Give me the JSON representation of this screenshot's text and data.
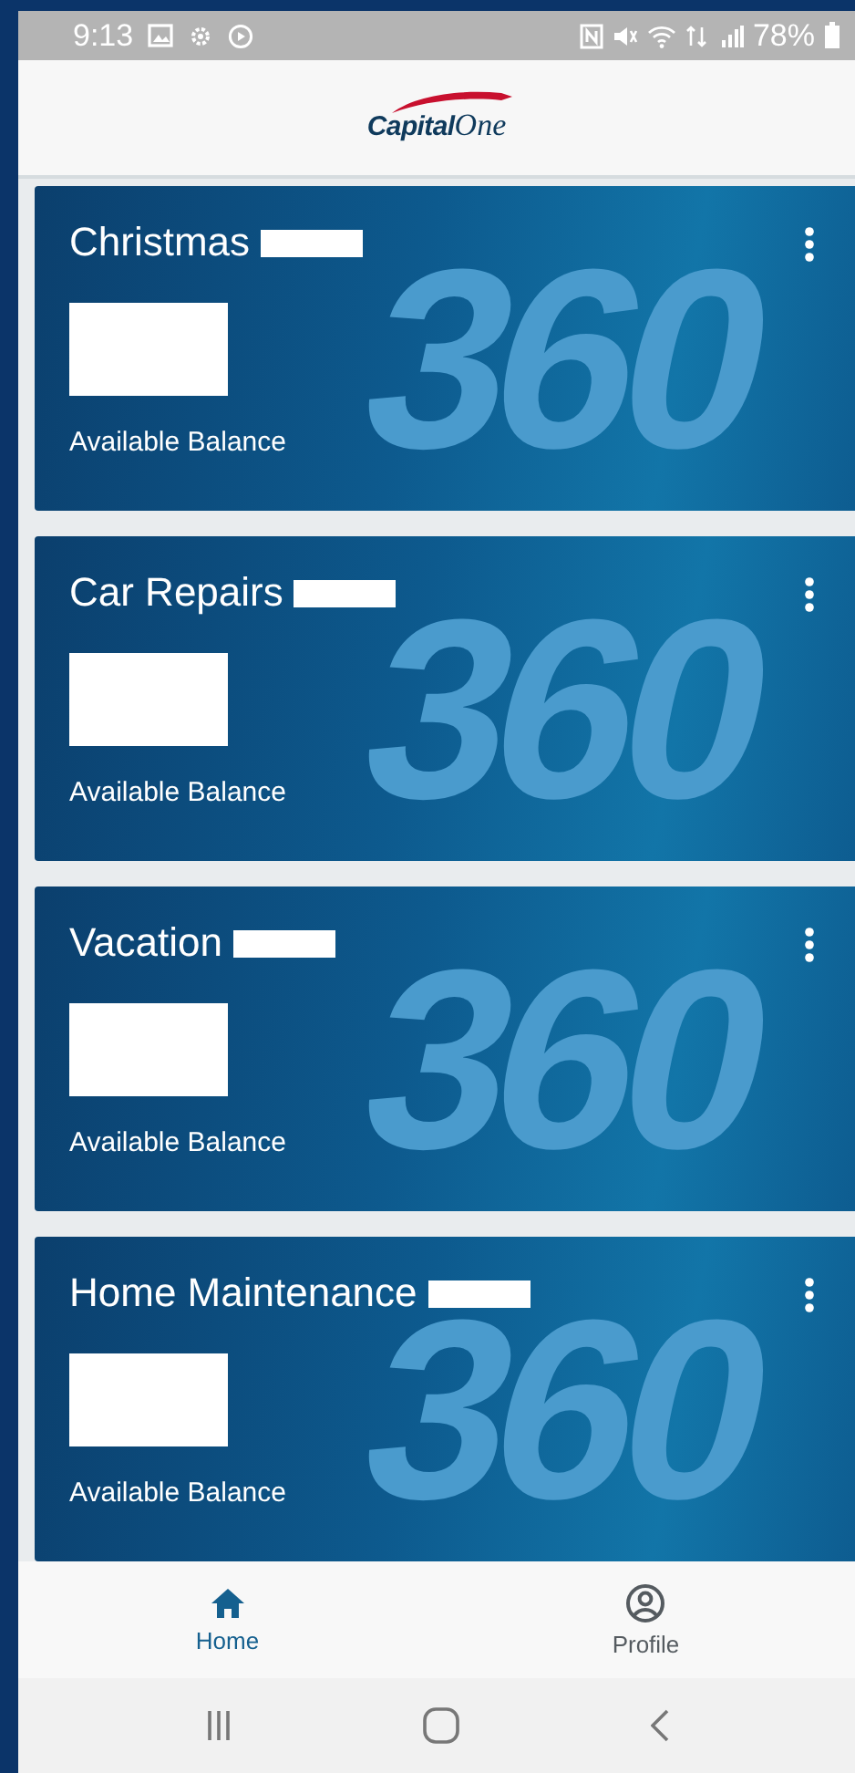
{
  "status_bar": {
    "time": "9:13",
    "battery": "78%"
  },
  "header": {
    "logo": {
      "bold": "Capital",
      "script": "One"
    }
  },
  "accounts": [
    {
      "name": "Christmas",
      "redacted": true,
      "balance_label": "Available Balance",
      "watermark": "360"
    },
    {
      "name": "Car Repairs",
      "redacted": true,
      "balance_label": "Available Balance",
      "watermark": "360"
    },
    {
      "name": "Vacation",
      "redacted": true,
      "balance_label": "Available Balance",
      "watermark": "360"
    },
    {
      "name": "Home Maintenance",
      "redacted": true,
      "balance_label": "Available Balance",
      "watermark": "360"
    }
  ],
  "bottom_nav": [
    {
      "kind": "home",
      "label": "Home",
      "selected": true
    },
    {
      "kind": "profile",
      "label": "Profile",
      "selected": false
    }
  ]
}
